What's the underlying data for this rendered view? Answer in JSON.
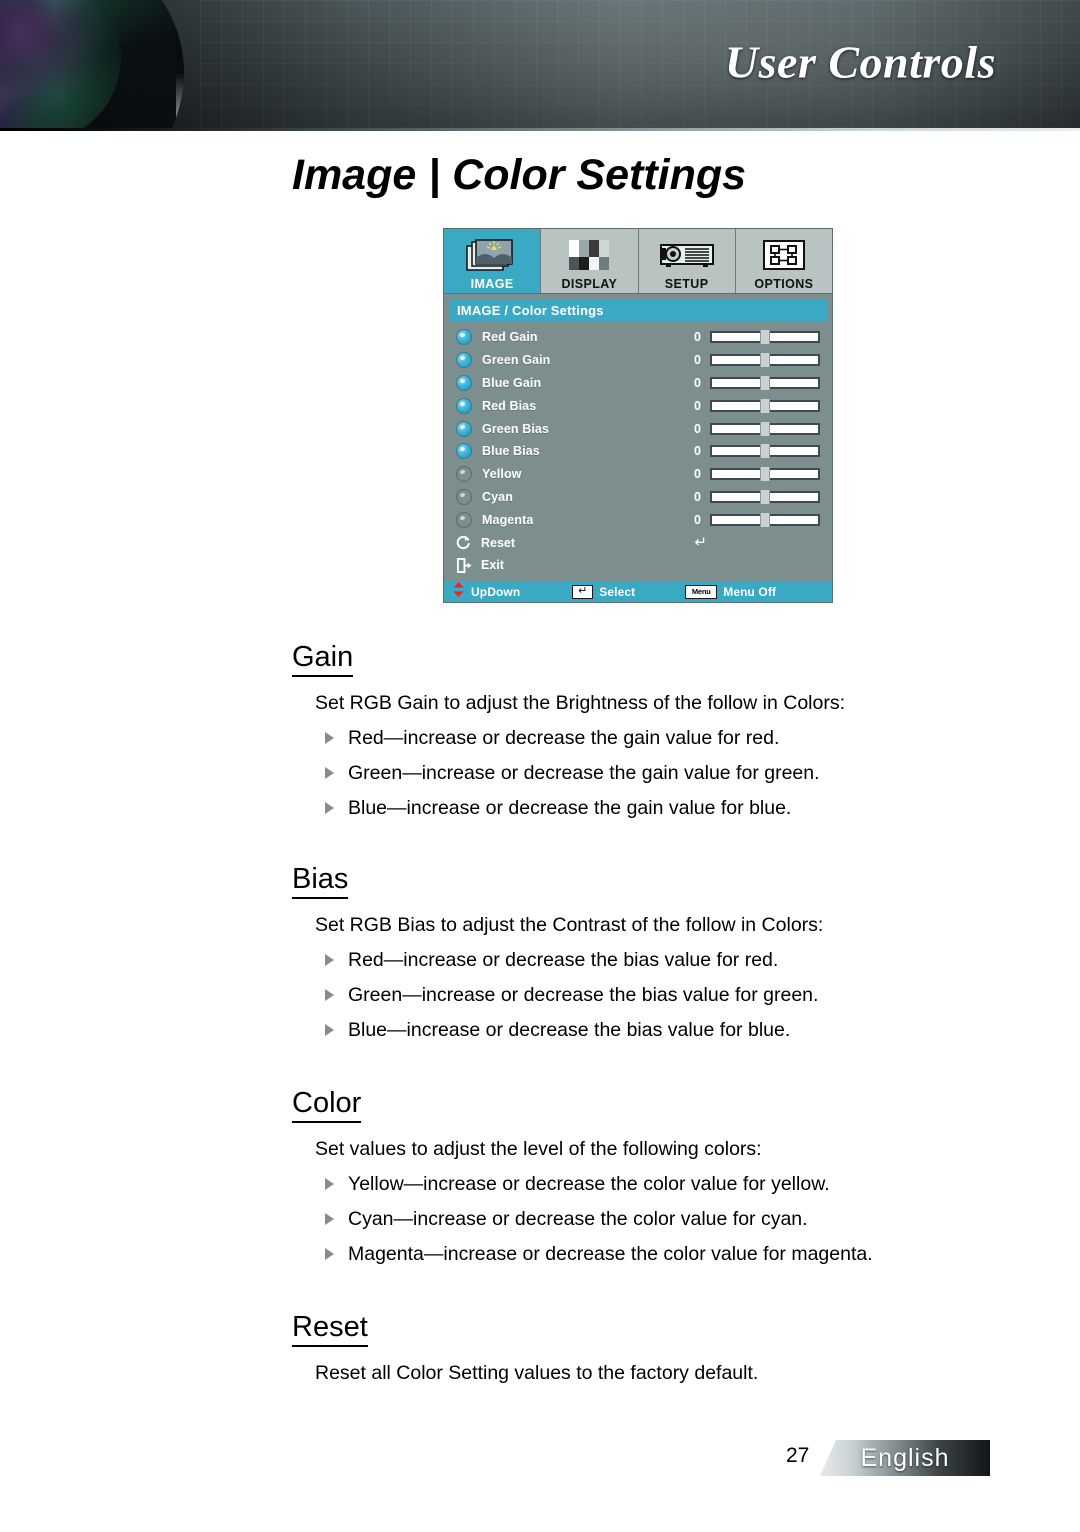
{
  "header": {
    "title": "User Controls",
    "lens_icon": "camera-lens-image"
  },
  "page_title": "Image | Color Settings",
  "osd": {
    "tabs": [
      {
        "label": "IMAGE",
        "icon": "image-photo-icon",
        "active": true
      },
      {
        "label": "DISPLAY",
        "icon": "display-bars-icon",
        "active": false
      },
      {
        "label": "SETUP",
        "icon": "projector-icon",
        "active": false
      },
      {
        "label": "OPTIONS",
        "icon": "options-grid-icon",
        "active": false
      }
    ],
    "header_text": "IMAGE / Color Settings",
    "rows": [
      {
        "label": "Red Gain",
        "value": "0",
        "selected": true
      },
      {
        "label": "Green Gain",
        "value": "0",
        "selected": true
      },
      {
        "label": "Blue Gain",
        "value": "0",
        "selected": true
      },
      {
        "label": "Red Bias",
        "value": "0",
        "selected": true
      },
      {
        "label": "Green Bias",
        "value": "0",
        "selected": true
      },
      {
        "label": "Blue Bias",
        "value": "0",
        "selected": true
      },
      {
        "label": "Yellow",
        "value": "0",
        "selected": false
      },
      {
        "label": "Cyan",
        "value": "0",
        "selected": false
      },
      {
        "label": "Magenta",
        "value": "0",
        "selected": false
      }
    ],
    "actions": [
      {
        "label": "Reset",
        "icon": "refresh-circular-arrow-icon",
        "enter": "↵"
      },
      {
        "label": "Exit",
        "icon": "exit-door-icon",
        "enter": ""
      }
    ],
    "footer": {
      "updown_label": "UpDown",
      "updown_icon": "up-down-arrows-icon",
      "select_label": "Select",
      "select_key": "↵",
      "menu_label": "Menu Off",
      "menu_key": "Menu"
    },
    "colors": {
      "accent": "#3aa9c4",
      "panel": "#7d8e8f",
      "tab": "#b9c4c2",
      "knob_on": "#3bb4d6"
    }
  },
  "sections": [
    {
      "heading": "Gain",
      "intro": "Set RGB Gain to adjust the Brightness of the follow in Colors:",
      "bullets": [
        "Red—increase or decrease the gain value for red.",
        "Green—increase or decrease the gain value for green.",
        "Blue—increase or decrease the gain value for blue."
      ]
    },
    {
      "heading": "Bias",
      "intro": "Set RGB Bias to adjust the Contrast of the follow in Colors:",
      "bullets": [
        "Red—increase or decrease the bias value for red.",
        "Green—increase or decrease the bias value for green.",
        "Blue—increase or decrease the bias value for blue."
      ]
    },
    {
      "heading": "Color",
      "intro": "Set values to adjust the level of the following colors:",
      "bullets": [
        "Yellow—increase or decrease the color value for yellow.",
        "Cyan—increase or decrease the color value for cyan.",
        "Magenta—increase or decrease the color value for magenta."
      ]
    },
    {
      "heading": "Reset",
      "intro": "Reset all Color Setting values to the factory default.",
      "bullets": []
    }
  ],
  "footer": {
    "page_number": "27",
    "language": "English"
  }
}
